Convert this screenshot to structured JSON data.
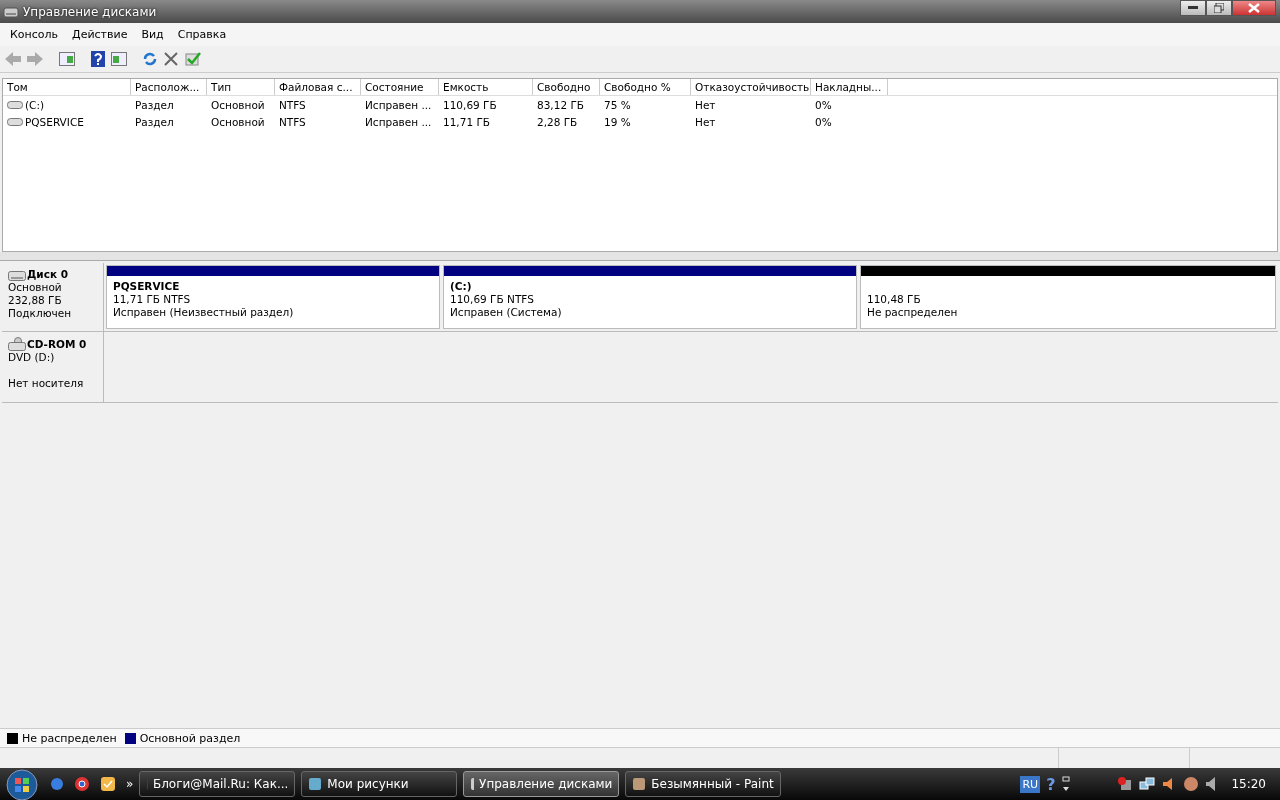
{
  "window": {
    "title": "Управление дисками"
  },
  "menu": [
    "Консоль",
    "Действие",
    "Вид",
    "Справка"
  ],
  "table": {
    "columns": [
      "Том",
      "Располож...",
      "Тип",
      "Файловая с...",
      "Состояние",
      "Емкость",
      "Свободно",
      "Свободно %",
      "Отказоустойчивость",
      "Накладны..."
    ],
    "rows": [
      {
        "cells": [
          "(C:)",
          "Раздел",
          "Основной",
          "NTFS",
          "Исправен ...",
          "110,69 ГБ",
          "83,12 ГБ",
          "75 %",
          "Нет",
          "0%"
        ]
      },
      {
        "cells": [
          "PQSERVICE",
          "Раздел",
          "Основной",
          "NTFS",
          "Исправен ...",
          "11,71 ГБ",
          "2,28 ГБ",
          "19 %",
          "Нет",
          "0%"
        ]
      }
    ]
  },
  "disks": [
    {
      "kind": "disk",
      "name": "Диск 0",
      "lines": [
        "Основной",
        "232,88 ГБ",
        "Подключен"
      ],
      "partitions": [
        {
          "kind": "primary",
          "title": "PQSERVICE",
          "size": "11,71 ГБ NTFS",
          "status": "Исправен (Неизвестный раздел)"
        },
        {
          "kind": "primary",
          "title": "(C:)",
          "size": "110,69 ГБ NTFS",
          "status": "Исправен (Система)"
        },
        {
          "kind": "unallocated",
          "size": "110,48 ГБ",
          "status": "Не распределен"
        }
      ]
    },
    {
      "kind": "cdrom",
      "name": "CD-ROM 0",
      "lines": [
        "DVD (D:)",
        "Нет носителя"
      ]
    }
  ],
  "legend": [
    {
      "label": "Не распределен",
      "color": "#000000"
    },
    {
      "label": "Основной раздел",
      "color": "#000080"
    }
  ],
  "taskbar": {
    "overflow": "»",
    "buttons": [
      {
        "label": "Блоги@Mail.Ru: Как...",
        "selected": false
      },
      {
        "label": "Мои рисунки",
        "selected": false
      },
      {
        "label": "Управление дисками",
        "selected": true
      },
      {
        "label": "Безымянный - Paint",
        "selected": false
      }
    ],
    "language": "RU",
    "help": "?",
    "clock": "15:20"
  }
}
